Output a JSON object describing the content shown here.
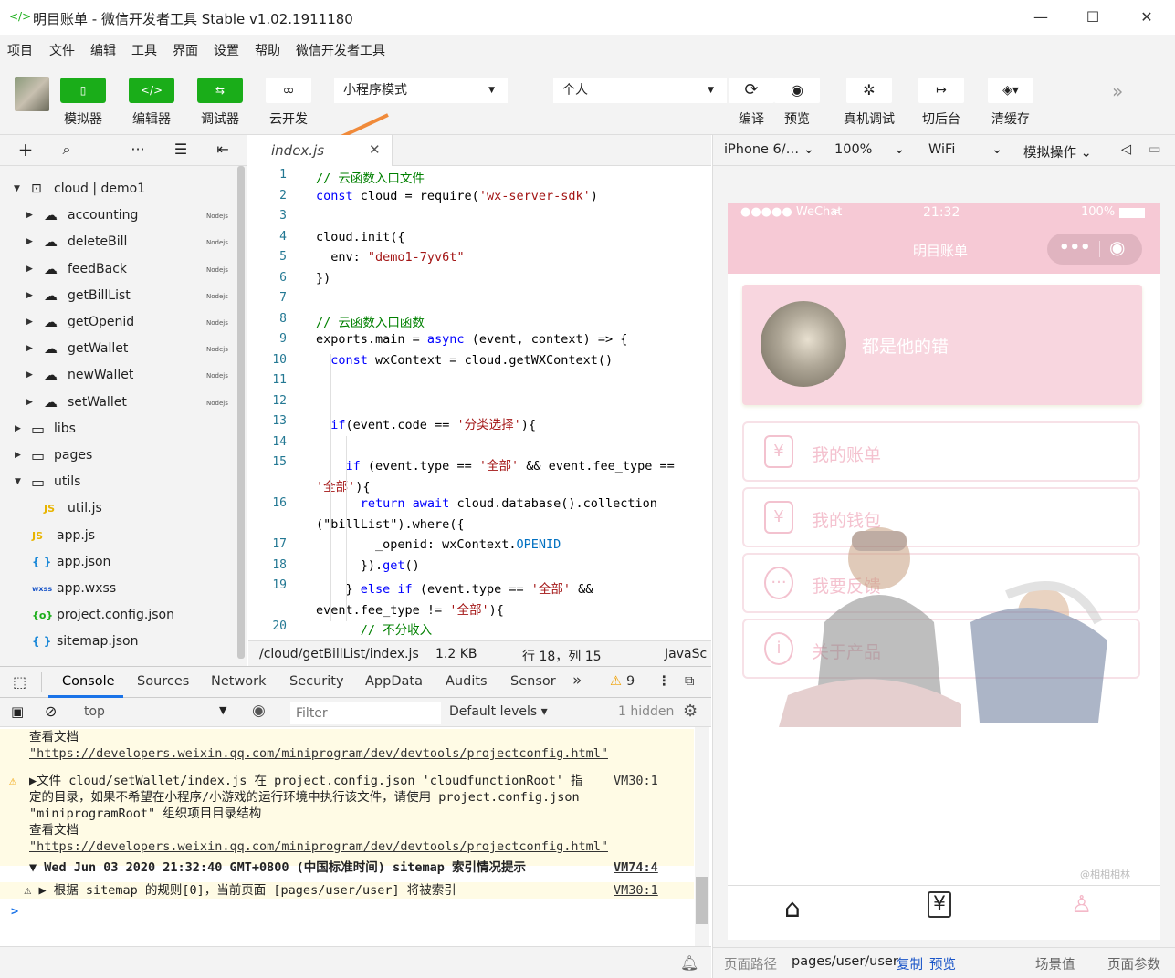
{
  "window": {
    "title": "明目账单 - 微信开发者工具 Stable v1.02.1911180"
  },
  "menu": [
    "项目",
    "文件",
    "编辑",
    "工具",
    "界面",
    "设置",
    "帮助",
    "微信开发者工具"
  ],
  "toolbar": {
    "simulator": "模拟器",
    "editor": "编辑器",
    "debugger": "调试器",
    "cloud": "云开发",
    "mode": "小程序模式",
    "account": "个人",
    "compile": "编译",
    "preview": "预览",
    "remote_debug": "真机调试",
    "background": "切后台",
    "clear_cache": "清缓存"
  },
  "tree": {
    "root": "cloud | demo1",
    "functions": [
      "accounting",
      "deleteBill",
      "feedBack",
      "getBillList",
      "getOpenid",
      "getWallet",
      "newWallet",
      "setWallet"
    ],
    "nodejs_badge": "Nodejs",
    "folders": [
      "libs",
      "pages",
      "utils"
    ],
    "util_file": "util.js",
    "files": [
      "app.js",
      "app.json",
      "app.wxss",
      "project.config.json",
      "sitemap.json"
    ],
    "icons": {
      "js": "JS",
      "json": "{ }",
      "wxss": "wxss",
      "config": "{o}"
    }
  },
  "editor": {
    "tab": "index.js",
    "status_path": "/cloud/getBillList/index.js",
    "status_size": "1.2 KB",
    "status_pos": "行 18，列 15",
    "status_lang": "JavaSc",
    "lines": [
      {
        "n": "1",
        "parts": [
          {
            "c": "cm",
            "t": "// 云函数入口文件"
          }
        ]
      },
      {
        "n": "2",
        "parts": [
          {
            "c": "kw",
            "t": "const"
          },
          {
            "c": "",
            "t": " cloud = require("
          },
          {
            "c": "st",
            "t": "'wx-server-sdk'"
          },
          {
            "c": "",
            "t": ")"
          }
        ]
      },
      {
        "n": "3",
        "parts": []
      },
      {
        "n": "4",
        "parts": [
          {
            "c": "",
            "t": "cloud.init({"
          }
        ]
      },
      {
        "n": "5",
        "parts": [
          {
            "c": "",
            "t": "  env: "
          },
          {
            "c": "st",
            "t": "\"demo1-7yv6t\""
          }
        ]
      },
      {
        "n": "6",
        "parts": [
          {
            "c": "",
            "t": "})"
          }
        ]
      },
      {
        "n": "7",
        "parts": []
      },
      {
        "n": "8",
        "parts": [
          {
            "c": "cm",
            "t": "// 云函数入口函数"
          }
        ]
      },
      {
        "n": "9",
        "parts": [
          {
            "c": "",
            "t": "exports.main = "
          },
          {
            "c": "kw",
            "t": "async"
          },
          {
            "c": "",
            "t": " (event, context) => {"
          }
        ]
      },
      {
        "n": "10",
        "parts": [
          {
            "c": "",
            "t": "  "
          },
          {
            "c": "kw",
            "t": "const"
          },
          {
            "c": "",
            "t": " wxContext = cloud.getWXContext()"
          }
        ]
      },
      {
        "n": "11",
        "parts": []
      },
      {
        "n": "12",
        "parts": []
      },
      {
        "n": "13",
        "parts": [
          {
            "c": "",
            "t": "  "
          },
          {
            "c": "kw",
            "t": "if"
          },
          {
            "c": "",
            "t": "(event.code == "
          },
          {
            "c": "st",
            "t": "'分类选择'"
          },
          {
            "c": "",
            "t": "){"
          }
        ]
      },
      {
        "n": "14",
        "parts": []
      },
      {
        "n": "15",
        "parts": [
          {
            "c": "",
            "t": "    "
          },
          {
            "c": "kw",
            "t": "if"
          },
          {
            "c": "",
            "t": " (event.type == "
          },
          {
            "c": "st",
            "t": "'全部'"
          },
          {
            "c": "",
            "t": " && event.fee_type =="
          }
        ]
      },
      {
        "n": "",
        "parts": [
          {
            "c": "st",
            "t": "'全部'"
          },
          {
            "c": "",
            "t": "){"
          }
        ]
      },
      {
        "n": "16",
        "parts": [
          {
            "c": "",
            "t": "      "
          },
          {
            "c": "kw",
            "t": "return await"
          },
          {
            "c": "",
            "t": " cloud.database().collection"
          }
        ]
      },
      {
        "n": "",
        "parts": [
          {
            "c": "",
            "t": "(\"billList\").where({"
          }
        ]
      },
      {
        "n": "17",
        "parts": [
          {
            "c": "",
            "t": "        _openid: wxContext."
          },
          {
            "c": "pr",
            "t": "OPENID"
          }
        ]
      },
      {
        "n": "18",
        "parts": [
          {
            "c": "",
            "t": "      })."
          },
          {
            "c": "kw",
            "t": "get"
          },
          {
            "c": "",
            "t": "()"
          }
        ]
      },
      {
        "n": "19",
        "parts": [
          {
            "c": "",
            "t": "    } "
          },
          {
            "c": "kw",
            "t": "else if"
          },
          {
            "c": "",
            "t": " (event.type == "
          },
          {
            "c": "st",
            "t": "'全部'"
          },
          {
            "c": "",
            "t": " &&"
          }
        ]
      },
      {
        "n": "",
        "parts": [
          {
            "c": "",
            "t": "event.fee_type != "
          },
          {
            "c": "st",
            "t": "'全部'"
          },
          {
            "c": "",
            "t": "){"
          }
        ]
      },
      {
        "n": "20",
        "parts": [
          {
            "c": "",
            "t": "      "
          },
          {
            "c": "cm",
            "t": "// 不分收入"
          }
        ]
      }
    ]
  },
  "devtools": {
    "tabs": [
      "Console",
      "Sources",
      "Network",
      "Security",
      "AppData",
      "Audits",
      "Sensor"
    ],
    "more": "»",
    "warn_count": "9",
    "context": "top",
    "filter_placeholder": "Filter",
    "levels": "Default levels",
    "hidden": "1 hidden",
    "log": [
      {
        "t": "查看文档",
        "cls": "warn"
      },
      {
        "t": "\"https://developers.weixin.qq.com/miniprogram/dev/devtools/projectconfig.html\"",
        "cls": "warn link"
      },
      {
        "t": "▶文件 cloud/setWallet/index.js 在 project.config.json 'cloudfunctionRoot' 指",
        "cls": "warn",
        "src": "VM30:1",
        "icon": "⚠"
      },
      {
        "t": "定的目录，如果不希望在小程序/小游戏的运行环境中执行该文件，请使用 project.config.json",
        "cls": "warn"
      },
      {
        "t": "\"miniprogramRoot\" 组织项目目录结构",
        "cls": "warn"
      },
      {
        "t": "查看文档",
        "cls": "warn"
      },
      {
        "t": "\"https://developers.weixin.qq.com/miniprogram/dev/devtools/projectconfig.html\"",
        "cls": "warn link"
      },
      {
        "t": "▼ Wed Jun 03 2020 21:32:40 GMT+0800 (中国标准时间) sitemap 索引情况提示",
        "cls": "bold",
        "src": "VM74:4"
      },
      {
        "t": "  ⚠ ▶ 根据 sitemap 的规则[0]，当前页面 [pages/user/user] 将被索引",
        "cls": "warn",
        "src": "VM30:1"
      }
    ],
    "prompt": ">"
  },
  "sim": {
    "device": "iPhone 6/…",
    "zoom": "100%",
    "network": "WiFi",
    "ops": "模拟操作",
    "status_left": "●●●●● WeChat",
    "status_time": "21:32",
    "status_batt": "100%",
    "nav_title": "明目账单",
    "username": "都是他的错",
    "menu": [
      "我的账单",
      "我的钱包",
      "我要反馈",
      "关于产品"
    ],
    "menu_icons": [
      "¥",
      "¥",
      "···",
      "i"
    ],
    "watermark": "@相相相林",
    "footer_label": "页面路径",
    "footer_path": "pages/user/user",
    "copy": "复制",
    "preview": "预览",
    "scene": "场景值",
    "params": "页面参数"
  }
}
